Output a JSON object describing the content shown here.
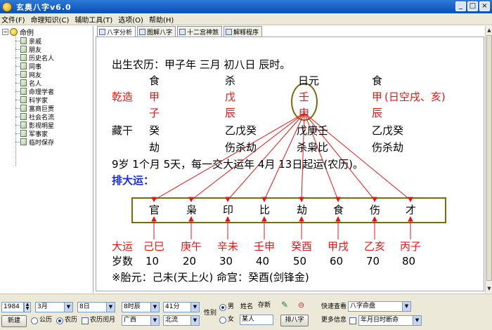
{
  "window": {
    "title": "玄奥八字v6.0"
  },
  "menu": [
    "文件(F)",
    "命理知识(C)",
    "辅助工具(T)",
    "选项(O)",
    "帮助(H)"
  ],
  "tree": {
    "root": "命例",
    "items": [
      "亲戚",
      "朋友",
      "历史名人",
      "同事",
      "网友",
      "名人",
      "命理学者",
      "科学家",
      "富商巨贾",
      "社会名流",
      "影视明星",
      "军事家",
      "临时保存"
    ]
  },
  "tabs": [
    "八字分析",
    "图解八字",
    "十二宫神煞",
    "解释程序"
  ],
  "chart": {
    "birth_line": "出生农历：甲子年  三月  初八日  辰时。",
    "gods_top": [
      "食",
      "杀",
      "日元",
      "食"
    ],
    "qianzao_label": "乾造",
    "stems": [
      "甲",
      "戊",
      "壬",
      "甲"
    ],
    "kong_note": "(日空戌、亥)",
    "branches": [
      "子",
      "辰",
      "申",
      "辰"
    ],
    "canggan_label": "藏干",
    "hidden": [
      "癸",
      "乙戊癸",
      "戊庚壬",
      "乙戊癸"
    ],
    "hidden_gods": [
      "劫",
      "伤杀劫",
      "杀枭比",
      "伤杀劫"
    ],
    "luck_start": "9岁 1个月 5天，每一交大运年 4月 13日起运(农历)。",
    "pai_dayun": "排大运：",
    "dayun_gods": [
      "官",
      "枭",
      "印",
      "比",
      "劫",
      "食",
      "伤",
      "才"
    ],
    "dayun_label": "大运",
    "dayun": [
      "己巳",
      "庚午",
      "辛未",
      "壬申",
      "癸酉",
      "甲戌",
      "乙亥",
      "丙子"
    ],
    "age_label": "岁数",
    "ages": [
      "10",
      "20",
      "30",
      "40",
      "50",
      "60",
      "70",
      "80"
    ],
    "taiyuan_line": "※胎元：己未(天上火)   命宫：癸酉(剑锋金)"
  },
  "form": {
    "year": "1984",
    "month": "3月",
    "day": "8日",
    "hour": "8时辰",
    "minute": "41分",
    "new_button": "新建",
    "gongli": "公历",
    "nongli": "农历",
    "nongli_run": "农历闰月",
    "province": "广西",
    "city": "北流",
    "gender_label": "性别",
    "male": "男",
    "female": "女",
    "name_label": "姓名",
    "name_value": "某人",
    "save_label": "存新",
    "paipan_button": "排八字",
    "quick_view_label": "快速查看",
    "quick_view_value": "八字命盘",
    "more_info_label": "更多信息",
    "more_info_value": "年月日时断命"
  },
  "colors": {
    "red": "#e01818",
    "blue": "#1b2fd8",
    "olive": "#7a6a10"
  }
}
